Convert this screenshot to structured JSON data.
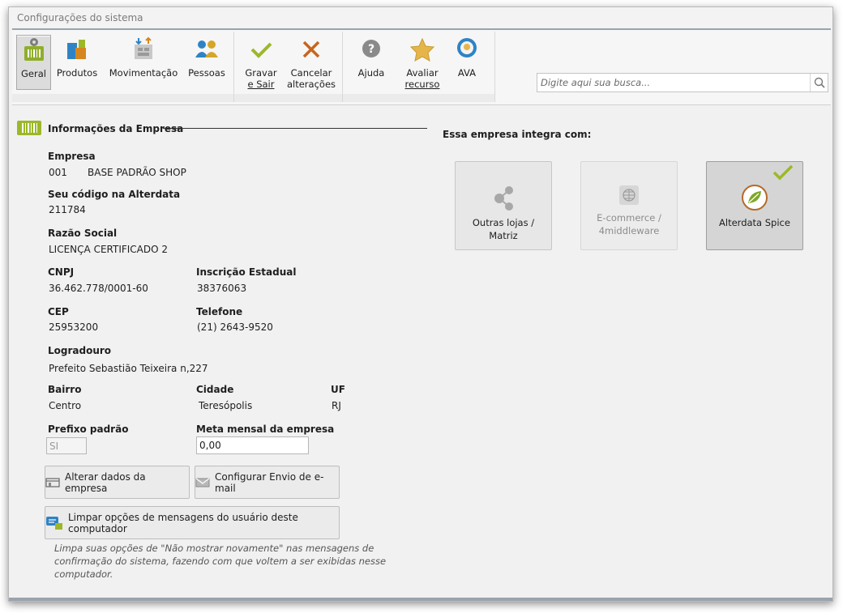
{
  "window": {
    "title": "Configurações do sistema"
  },
  "ribbon": {
    "geral": "Geral",
    "produtos": "Produtos",
    "movimentacao": "Movimentação",
    "pessoas": "Pessoas",
    "gravar_1": "Gravar",
    "gravar_2": "e Sair",
    "cancelar_1": "Cancelar",
    "cancelar_2": "alterações",
    "ajuda": "Ajuda",
    "avaliar_1": "Avaliar",
    "avaliar_2": "recurso",
    "ava": "AVA"
  },
  "search": {
    "placeholder": "Digite aqui sua busca..."
  },
  "section": {
    "title": "Informações da Empresa"
  },
  "empresa": {
    "label": "Empresa",
    "code": "001",
    "name": "BASE PADRÃO SHOP",
    "codigo_label": "Seu código na Alterdata",
    "codigo": "211784",
    "razao_label": "Razão Social",
    "razao": "LICENÇA CERTIFICADO 2",
    "cnpj_label": "CNPJ",
    "cnpj": "36.462.778/0001-60",
    "ie_label": "Inscrição Estadual",
    "ie": "38376063",
    "cep_label": "CEP",
    "cep": "25953200",
    "telefone_label": "Telefone",
    "telefone": "(21) 2643-9520",
    "logradouro_label": "Logradouro",
    "logradouro": "Prefeito Sebastião Teixeira n,227",
    "bairro_label": "Bairro",
    "bairro": "Centro",
    "cidade_label": "Cidade",
    "cidade": "Teresópolis",
    "uf_label": "UF",
    "uf": "RJ",
    "prefixo_label": "Prefixo padrão",
    "prefixo": "SI",
    "meta_label": "Meta mensal da empresa",
    "meta": "0,00"
  },
  "buttons": {
    "alterar": "Alterar dados da empresa",
    "email": "Configurar Envio de e-mail",
    "limpar": "Limpar opções de mensagens do usuário deste computador"
  },
  "hint": "Limpa suas opções de \"Não mostrar novamente\" nas mensagens de confirmação do sistema, fazendo com que voltem a ser exibidas nesse computador.",
  "integra": {
    "title": "Essa empresa integra com:",
    "cards": [
      {
        "line1": "Outras lojas /",
        "line2": "Matriz",
        "state": "enabled"
      },
      {
        "line1": "E-commerce /",
        "line2": "4middleware",
        "state": "disabled"
      },
      {
        "line1": "Alterdata Spice",
        "line2": "",
        "state": "selected"
      }
    ]
  },
  "colors": {
    "accent_green": "#9cb829",
    "cancel_orange": "#c8641e",
    "ribbon_border": "#9aa3ad"
  }
}
